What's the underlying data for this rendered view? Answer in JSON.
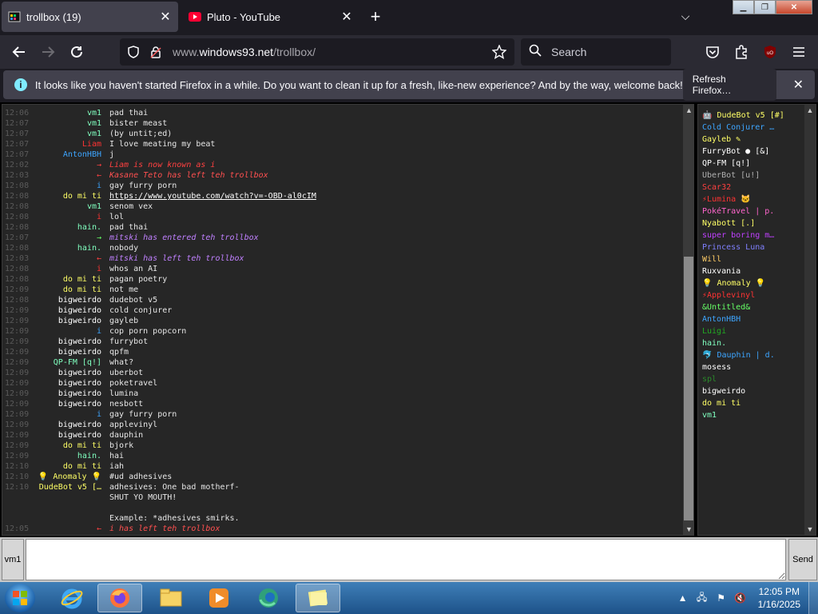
{
  "browser": {
    "tabs": [
      {
        "label": "trollbox (19)",
        "icon": "windows93-icon",
        "active": true
      },
      {
        "label": "Pluto - YouTube",
        "icon": "youtube-icon",
        "active": false
      }
    ],
    "url_prefix": "www.",
    "url_domain": "windows93.net",
    "url_path": "/trollbox/",
    "search_placeholder": "Search",
    "notification": {
      "message": "It looks like you haven't started Firefox in a while. Do you want to clean it up for a fresh, like-new experience? And by the way, welcome back!",
      "button": "Refresh Firefox…"
    }
  },
  "trollbox": {
    "messages": [
      {
        "time": "12:06",
        "nick": "vm1",
        "nick_color": "#80ffbf",
        "text": "pad thai",
        "type": "msg"
      },
      {
        "time": "12:07",
        "nick": "vm1",
        "nick_color": "#80ffbf",
        "text": "bister meast",
        "type": "msg"
      },
      {
        "time": "12:07",
        "nick": "vm1",
        "nick_color": "#80ffbf",
        "text": "(by untit;ed)",
        "type": "msg"
      },
      {
        "time": "12:07",
        "nick": "Liam",
        "nick_color": "#ff3333",
        "text": "I love meating my beat",
        "type": "msg"
      },
      {
        "time": "12:07",
        "nick": "AntonHBH",
        "nick_color": "#3da5ff",
        "text": "j",
        "type": "msg"
      },
      {
        "time": "12:02",
        "nick": "→",
        "nick_color": "#ff4040",
        "text": "Liam is now known as i",
        "type": "sys",
        "sys_color": "#ff4040"
      },
      {
        "time": "12:03",
        "nick": "←",
        "nick_color": "#ff4040",
        "text": "Kasane Teto has left teh trollbox",
        "type": "sys",
        "sys_color": "#ff5050"
      },
      {
        "time": "12:08",
        "nick": "i",
        "nick_color": "#3da5ff",
        "text": "gay furry porn",
        "type": "msg"
      },
      {
        "time": "12:08",
        "nick": "do mi ti",
        "nick_color": "#ffff66",
        "text": "https://www.youtube.com/watch?v=-OBD-al0cIM",
        "type": "link"
      },
      {
        "time": "12:08",
        "nick": "vm1",
        "nick_color": "#80ffbf",
        "text": "senom vex",
        "type": "msg"
      },
      {
        "time": "12:08",
        "nick": "i",
        "nick_color": "#ff3333",
        "text": "lol",
        "type": "msg"
      },
      {
        "time": "12:08",
        "nick": "hain.",
        "nick_color": "#80ffbf",
        "text": "pad thai",
        "type": "msg"
      },
      {
        "time": "12:07",
        "nick": "→",
        "nick_color": "#66ff66",
        "text": "mitski has entered teh trollbox",
        "type": "sys",
        "sys_color": "#c080ff"
      },
      {
        "time": "12:08",
        "nick": "hain.",
        "nick_color": "#80ffbf",
        "text": "nobody",
        "type": "msg"
      },
      {
        "time": "12:03",
        "nick": "←",
        "nick_color": "#ff4040",
        "text": "mitski has left teh trollbox",
        "type": "sys",
        "sys_color": "#c080ff"
      },
      {
        "time": "12:08",
        "nick": "i",
        "nick_color": "#ff3333",
        "text": "whos an AI",
        "type": "msg"
      },
      {
        "time": "12:08",
        "nick": "do mi ti",
        "nick_color": "#ffff66",
        "text": "pagan poetry",
        "type": "msg"
      },
      {
        "time": "12:09",
        "nick": "do mi ti",
        "nick_color": "#ffff66",
        "text": "not me",
        "type": "msg"
      },
      {
        "time": "12:08",
        "nick": "bigweirdo",
        "nick_color": "#ffffff",
        "text": "dudebot v5",
        "type": "msg"
      },
      {
        "time": "12:09",
        "nick": "bigweirdo",
        "nick_color": "#ffffff",
        "text": "cold conjurer",
        "type": "msg"
      },
      {
        "time": "12:09",
        "nick": "bigweirdo",
        "nick_color": "#ffffff",
        "text": "gayleb",
        "type": "msg"
      },
      {
        "time": "12:09",
        "nick": "i",
        "nick_color": "#3da5ff",
        "text": "cop porn popcorn",
        "type": "msg"
      },
      {
        "time": "12:09",
        "nick": "bigweirdo",
        "nick_color": "#ffffff",
        "text": "furrybot",
        "type": "msg"
      },
      {
        "time": "12:09",
        "nick": "bigweirdo",
        "nick_color": "#ffffff",
        "text": "qpfm",
        "type": "msg"
      },
      {
        "time": "12:09",
        "nick": "QP-FM [q!]",
        "nick_color": "#80ffbf",
        "text": "what?",
        "type": "msg"
      },
      {
        "time": "12:09",
        "nick": "bigweirdo",
        "nick_color": "#ffffff",
        "text": "uberbot",
        "type": "msg"
      },
      {
        "time": "12:09",
        "nick": "bigweirdo",
        "nick_color": "#ffffff",
        "text": "poketravel",
        "type": "msg"
      },
      {
        "time": "12:09",
        "nick": "bigweirdo",
        "nick_color": "#ffffff",
        "text": "lumina",
        "type": "msg"
      },
      {
        "time": "12:09",
        "nick": "bigweirdo",
        "nick_color": "#ffffff",
        "text": "nesbott",
        "type": "msg"
      },
      {
        "time": "12:09",
        "nick": "i",
        "nick_color": "#3da5ff",
        "text": "gay furry porn",
        "type": "msg"
      },
      {
        "time": "12:09",
        "nick": "bigweirdo",
        "nick_color": "#ffffff",
        "text": "applevinyl",
        "type": "msg"
      },
      {
        "time": "12:09",
        "nick": "bigweirdo",
        "nick_color": "#ffffff",
        "text": "dauphin",
        "type": "msg"
      },
      {
        "time": "12:09",
        "nick": "do mi ti",
        "nick_color": "#ffff66",
        "text": "bjork",
        "type": "msg"
      },
      {
        "time": "12:09",
        "nick": "hain.",
        "nick_color": "#80ffbf",
        "text": "hai",
        "type": "msg"
      },
      {
        "time": "12:10",
        "nick": "do mi ti",
        "nick_color": "#ffff66",
        "text": "iah",
        "type": "msg"
      },
      {
        "time": "12:10",
        "nick": "💡 Anomaly 💡",
        "nick_color": "#ffff66",
        "text": "#ud adhesives",
        "type": "msg"
      },
      {
        "time": "12:10",
        "nick": "DudeBot v5 […",
        "nick_color": "#ffff66",
        "text": "adhesives: One bad motherf-\nSHUT YO MOUTH!\n\nExample: *adhesives smirks.",
        "type": "multi"
      },
      {
        "time": "12:05",
        "nick": "←",
        "nick_color": "#ff4040",
        "text": "i has left teh trollbox",
        "type": "sys",
        "sys_color": "#ff5050"
      }
    ],
    "users": [
      {
        "name": "🤖 DudeBot v5 [#]",
        "color": "#ffff66"
      },
      {
        "name": "Cold Conjurer …",
        "color": "#3da5ff"
      },
      {
        "name": "Gayleb ✎",
        "color": "#ffff66"
      },
      {
        "name": "FurryBot ● [&]",
        "color": "#ffffff"
      },
      {
        "name": "QP-FM [q!]",
        "color": "#ffffff"
      },
      {
        "name": "UberBot [u!]",
        "color": "#b0b0b0"
      },
      {
        "name": "Scar32",
        "color": "#ff4040"
      },
      {
        "name": "⚡Lumina 🐱",
        "color": "#ff3333"
      },
      {
        "name": "PokéTravel | p.",
        "color": "#ff66cc"
      },
      {
        "name": "Nyabott [.]",
        "color": "#ffff66"
      },
      {
        "name": "super boring m…",
        "color": "#c040ff"
      },
      {
        "name": "Princess Luna",
        "color": "#8080ff"
      },
      {
        "name": "Will",
        "color": "#ffcc66"
      },
      {
        "name": "Ruxvania",
        "color": "#ffffff"
      },
      {
        "name": "💡 Anomaly 💡",
        "color": "#ffff66"
      },
      {
        "name": "⚡Applevinyl",
        "color": "#ff3333"
      },
      {
        "name": "&Untitled&",
        "color": "#66ff66"
      },
      {
        "name": "AntonHBH",
        "color": "#3da5ff"
      },
      {
        "name": "Luigi",
        "color": "#22aa22"
      },
      {
        "name": "hain.",
        "color": "#80ffbf"
      },
      {
        "name": "🐬 Dauphin | d.",
        "color": "#3da5ff"
      },
      {
        "name": "mosess",
        "color": "#ffffff"
      },
      {
        "name": "spl",
        "color": "#2a8a2a"
      },
      {
        "name": "bigweirdo",
        "color": "#ffffff"
      },
      {
        "name": "do mi ti",
        "color": "#ffff66"
      },
      {
        "name": "vm1",
        "color": "#80ffbf"
      }
    ],
    "nick_button": "vm1",
    "send_button": "Send",
    "input_value": ""
  },
  "taskbar": {
    "apps": [
      "start-orb",
      "internet-explorer",
      "firefox",
      "file-explorer",
      "media-player",
      "edge",
      "sticky-notes"
    ],
    "clock_time": "12:05 PM",
    "clock_date": "1/16/2025"
  }
}
